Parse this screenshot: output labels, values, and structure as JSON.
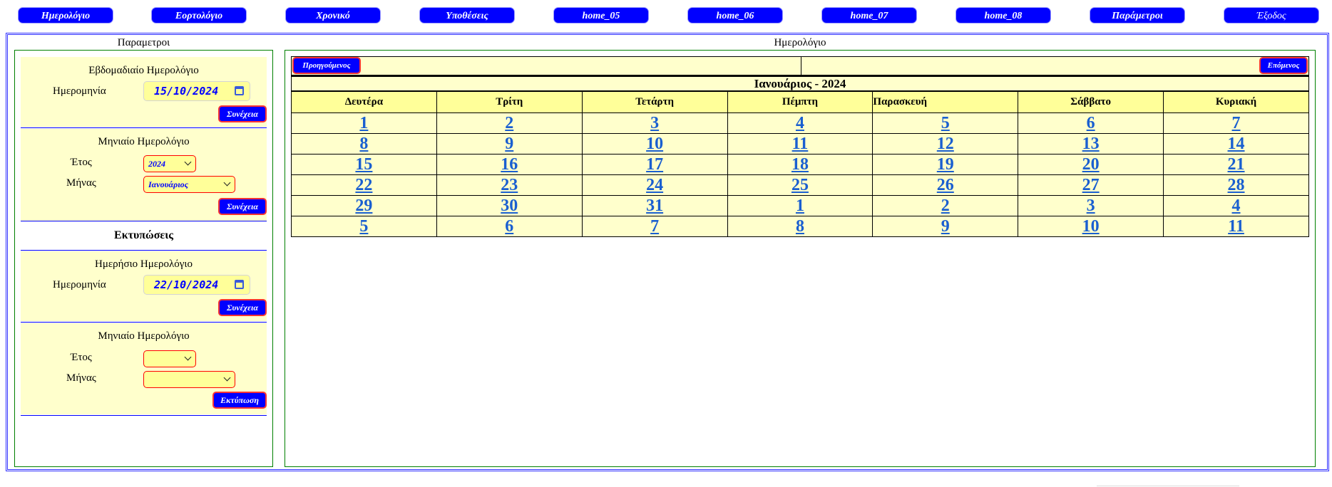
{
  "nav": [
    {
      "label": "Ημερολόγιο"
    },
    {
      "label": "Εορτολόγιο"
    },
    {
      "label": "Χρονικό"
    },
    {
      "label": "Υποθέσεις"
    },
    {
      "label": "home_05"
    },
    {
      "label": "home_06"
    },
    {
      "label": "home_07"
    },
    {
      "label": "home_08"
    },
    {
      "label": "Παράμετροι"
    },
    {
      "label": "Έξοδος"
    }
  ],
  "left": {
    "title": "Παραμετροι",
    "weekly": {
      "heading": "Εβδομαδιαίο Ημερολόγιο",
      "date_label": "Ημερομηνία",
      "date_value": "15/10/2024",
      "continue": "Συνέχεια"
    },
    "monthly": {
      "heading": "Μηνιαίο Ημερολόγιο",
      "year_label": "Έτος",
      "year_value": "2024",
      "month_label": "Μήνας",
      "month_value": "Ιανουάριος",
      "continue": "Συνέχεια"
    },
    "prints_heading": "Εκτυπώσεις",
    "daily": {
      "heading": "Ημερήσιο Ημερολόγιο",
      "date_label": "Ημερομηνία",
      "date_value": "22/10/2024",
      "continue": "Συνέχεια"
    },
    "monthly_print": {
      "heading": "Μηνιαίο Ημερολόγιο",
      "year_label": "Έτος",
      "year_value": "",
      "month_label": "Μήνας",
      "month_value": "",
      "print": "Εκτύπωση"
    }
  },
  "calendar": {
    "title": "Ημερολόγιο",
    "prev": "Προηγούμενος",
    "next": "Επόμενος",
    "month_year": "Ιανουάριος - 2024",
    "weekdays": [
      "Δευτέρα",
      "Τρίτη",
      "Τετάρτη",
      "Πέμπτη",
      "Παρασκευή",
      "Σάββατο",
      "Κυριακή"
    ],
    "weeks": [
      [
        "1",
        "2",
        "3",
        "4",
        "5",
        "6",
        "7"
      ],
      [
        "8",
        "9",
        "10",
        "11",
        "12",
        "13",
        "14"
      ],
      [
        "15",
        "16",
        "17",
        "18",
        "19",
        "20",
        "21"
      ],
      [
        "22",
        "23",
        "24",
        "25",
        "26",
        "27",
        "28"
      ],
      [
        "29",
        "30",
        "31",
        "1",
        "2",
        "3",
        "4"
      ],
      [
        "5",
        "6",
        "7",
        "8",
        "9",
        "10",
        "11"
      ]
    ]
  }
}
